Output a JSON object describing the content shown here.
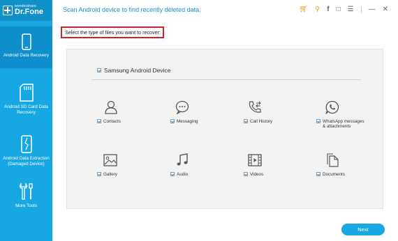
{
  "brand": {
    "small": "wondershare",
    "name": "Dr.Fone"
  },
  "sidebar": {
    "items": [
      {
        "label": "Android Data Recovery"
      },
      {
        "label": "Android SD Card Data Recovery"
      },
      {
        "label": "Android Data Extraction (Damaged Device)"
      },
      {
        "label": "More Tools"
      }
    ]
  },
  "header": {
    "title": "Scan Android device to find recently deleted data.",
    "icons": [
      "cart-icon",
      "key-icon",
      "facebook-icon",
      "feedback-icon",
      "menu-icon",
      "minimize-icon",
      "close-icon"
    ]
  },
  "instruction": "Select the type of files you want to recover:",
  "device": {
    "label": "Samsung Android Device",
    "checked": true
  },
  "file_types": [
    {
      "label": "Contacts",
      "icon": "contacts-icon",
      "checked": true
    },
    {
      "label": "Messaging",
      "icon": "messaging-icon",
      "checked": true
    },
    {
      "label": "Call History",
      "icon": "call-history-icon",
      "checked": true
    },
    {
      "label": "WhatsApp messages",
      "label2": "& attachments",
      "icon": "whatsapp-icon",
      "checked": true
    },
    {
      "label": "Gallery",
      "icon": "gallery-icon",
      "checked": true
    },
    {
      "label": "Audio",
      "icon": "audio-icon",
      "checked": true
    },
    {
      "label": "Videos",
      "icon": "videos-icon",
      "checked": true
    },
    {
      "label": "Documents",
      "icon": "documents-icon",
      "checked": true
    }
  ],
  "next_label": "Next",
  "colors": {
    "accent": "#17a8e3",
    "highlight": "#d0242b",
    "icon": "#555555"
  }
}
